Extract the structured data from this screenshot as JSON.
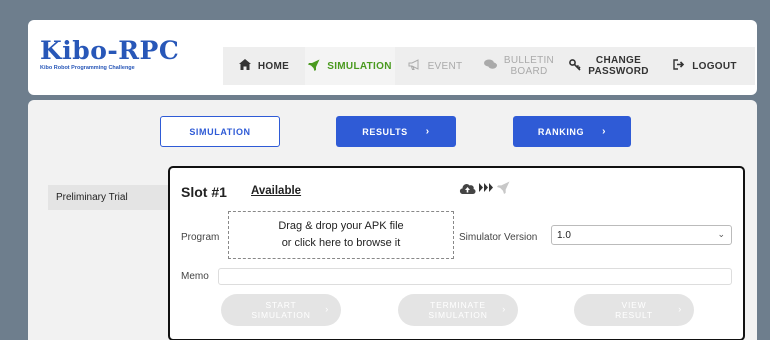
{
  "logo": {
    "title": "Kibo-RPC",
    "subtitle": "Kibo Robot Programming Challenge"
  },
  "nav": {
    "home": "HOME",
    "simulation": "SIMULATION",
    "event": "EVENT",
    "bulletin_line1": "BULLETIN",
    "bulletin_line2": "BOARD",
    "password_line1": "CHANGE",
    "password_line2": "PASSWORD",
    "logout": "LOGOUT"
  },
  "tabs": {
    "simulation": "SIMULATION",
    "results": "RESULTS",
    "ranking": "RANKING"
  },
  "sidebar": {
    "items": [
      {
        "label": "Preliminary Trial"
      }
    ]
  },
  "slot": {
    "title": "Slot #1",
    "status": "Available",
    "program_label": "Program",
    "dropzone_line1": "Drag & drop your APK file",
    "dropzone_line2": "or click here to browse it",
    "simver_label": "Simulator Version",
    "simver_value": "1.0",
    "memo_label": "Memo",
    "memo_value": "",
    "buttons": {
      "start_line1": "START",
      "start_line2": "SIMULATION",
      "terminate_line1": "TERMINATE",
      "terminate_line2": "SIMULATION",
      "view_line1": "VIEW",
      "view_line2": "RESULT"
    }
  },
  "colors": {
    "accent": "#2f5bd6",
    "active_nav": "#4a9a1f",
    "background": "#6e7e8d"
  }
}
